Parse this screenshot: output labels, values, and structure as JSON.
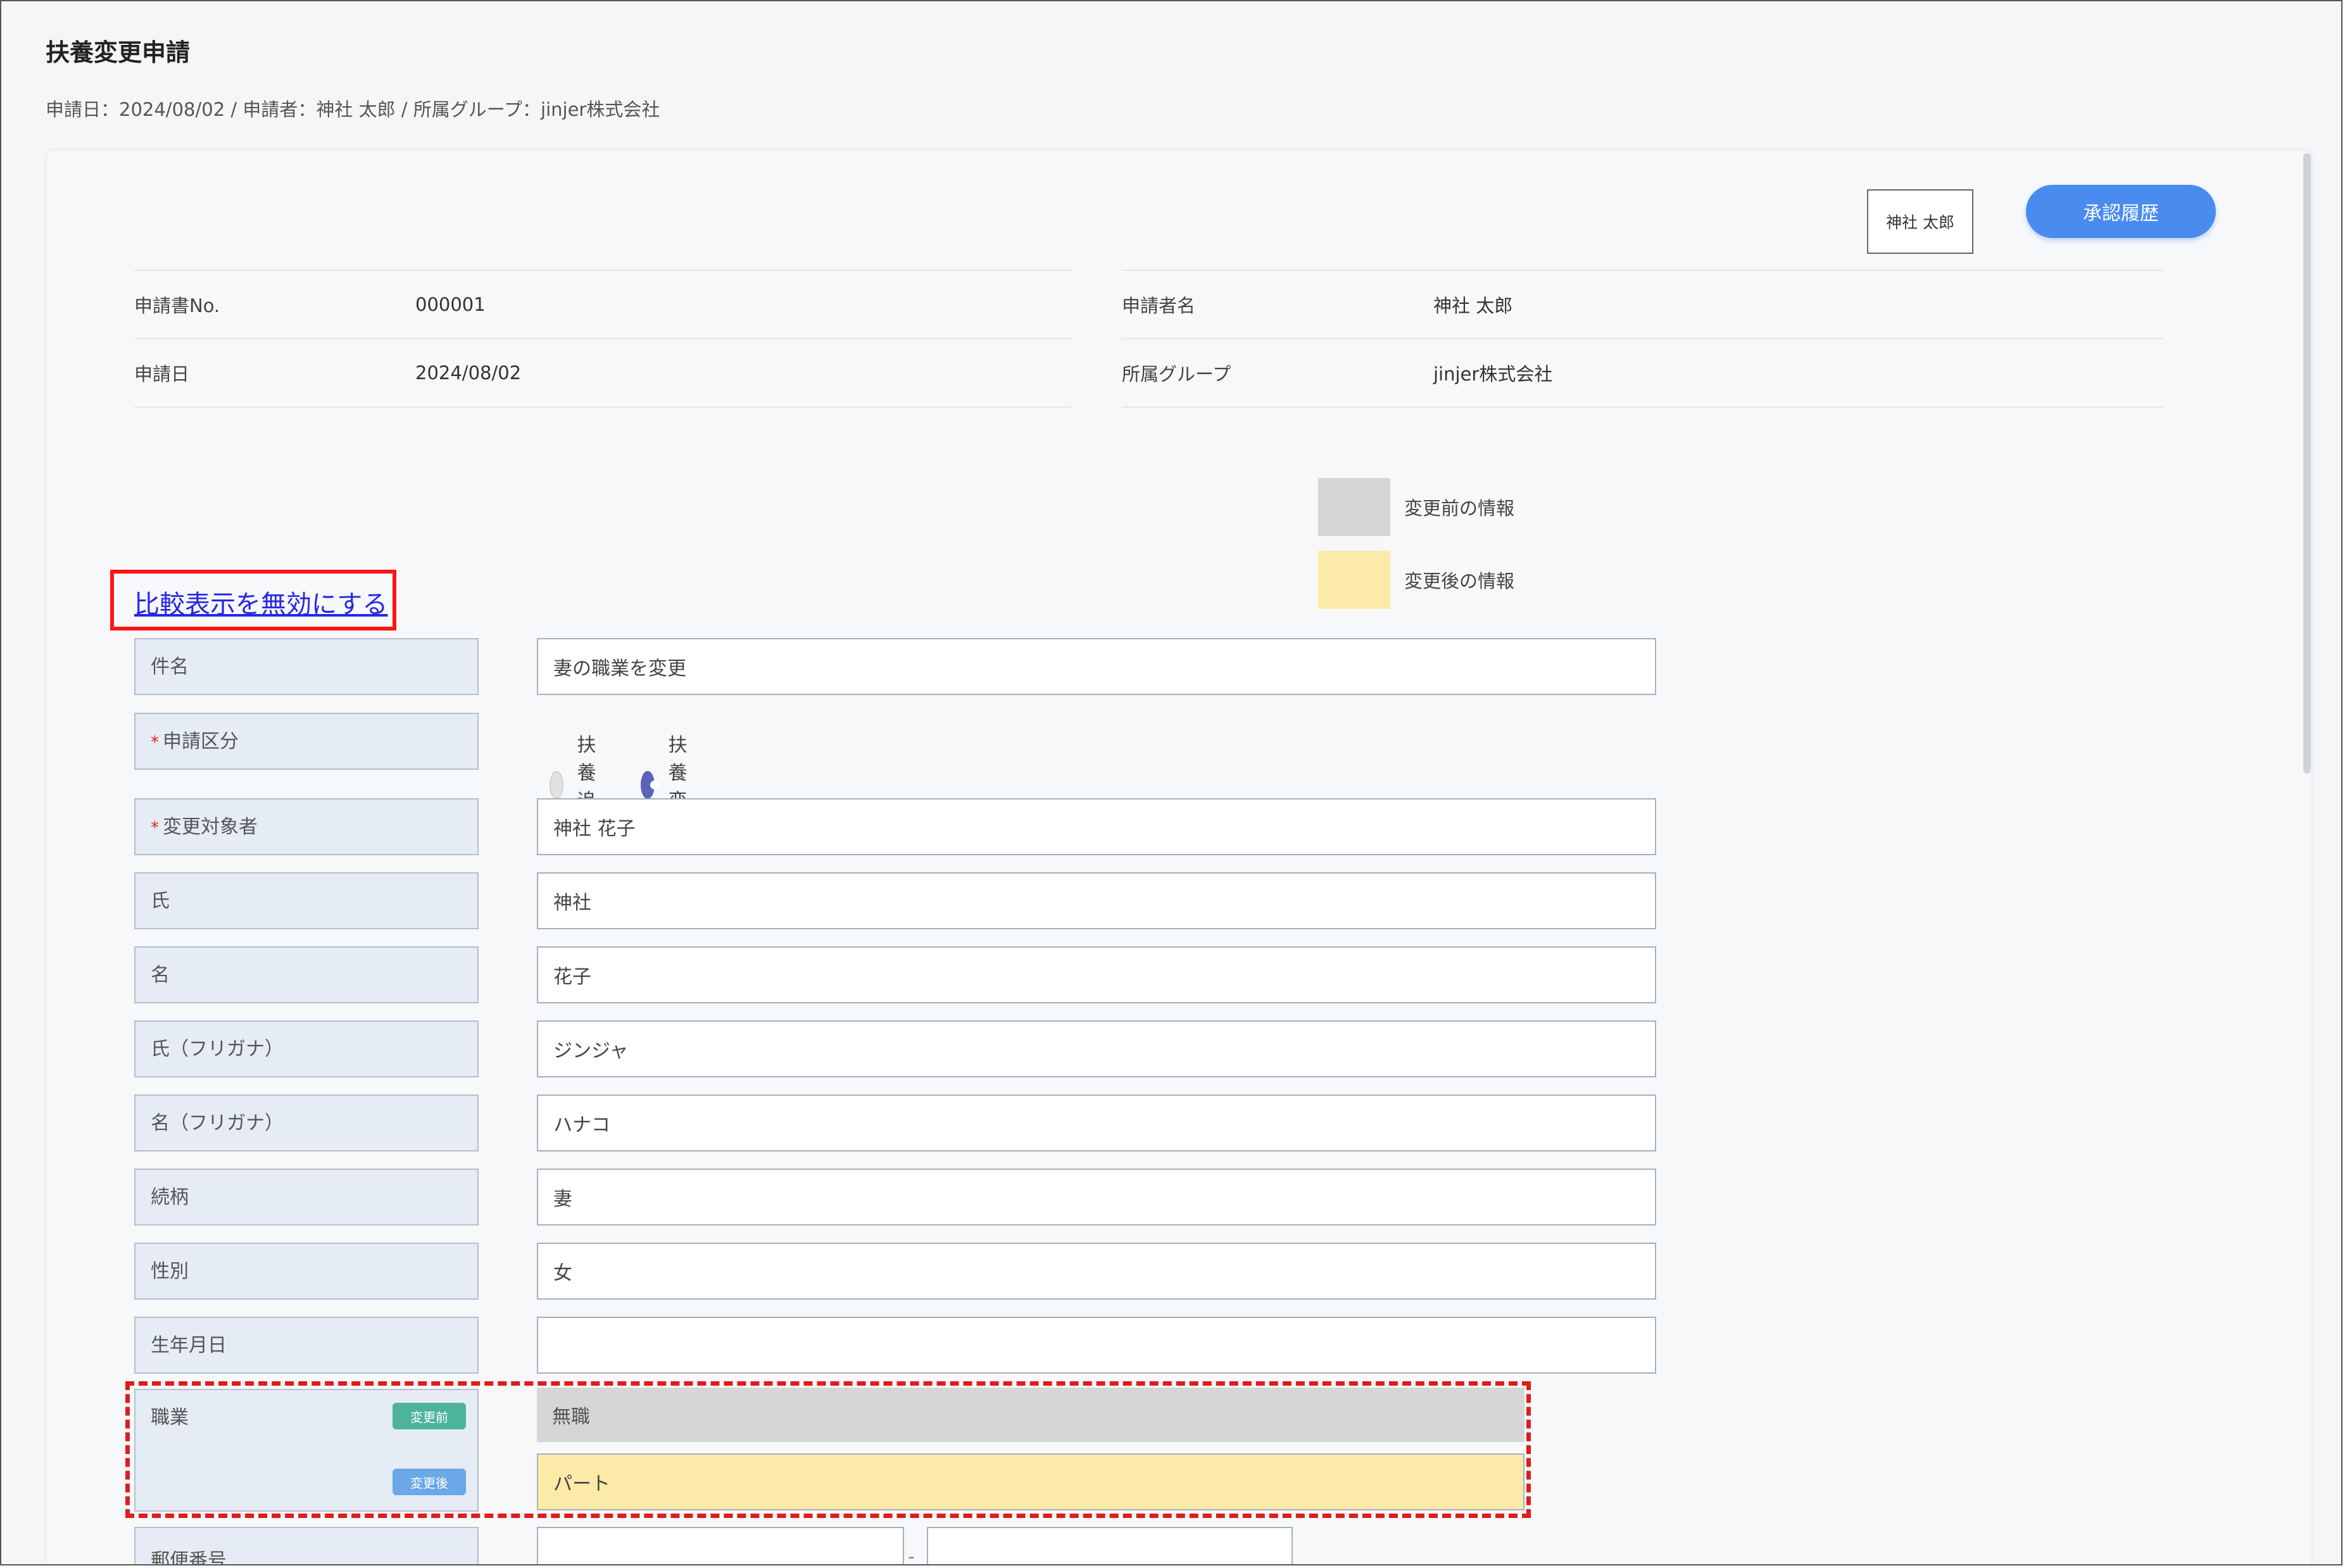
{
  "page": {
    "title": "扶養変更申請",
    "subtitle": "申請日：2024/08/02 / 申請者：神社 太郎 / 所属グループ：jinjer株式会社"
  },
  "header": {
    "approver_name": "神社 太郎",
    "history_button": "承認履歴"
  },
  "info": {
    "left": [
      {
        "label": "申請書No.",
        "value": "000001"
      },
      {
        "label": "申請日",
        "value": "2024/08/02"
      }
    ],
    "right": [
      {
        "label": "申請者名",
        "value": "神社 太郎"
      },
      {
        "label": "所属グループ",
        "value": "jinjer株式会社"
      }
    ]
  },
  "legend": {
    "before_label": "変更前の情報",
    "after_label": "変更後の情報",
    "before_color": "#d6d6d6",
    "after_color": "#fbeaa8"
  },
  "compare_toggle": "比較表示を無効にする",
  "form": {
    "subject": {
      "label": "件名",
      "value": "妻の職業を変更"
    },
    "application_type": {
      "label": "申請区分",
      "options": [
        {
          "label": "扶養追加",
          "selected": false
        },
        {
          "label": "扶養変更",
          "selected": true
        }
      ]
    },
    "target": {
      "label": "変更対象者",
      "value": "神社 花子"
    },
    "last_name": {
      "label": "氏",
      "value": "神社"
    },
    "first_name": {
      "label": "名",
      "value": "花子"
    },
    "last_name_kana": {
      "label": "氏（フリガナ）",
      "value": "ジンジャ"
    },
    "first_name_kana": {
      "label": "名（フリガナ）",
      "value": "ハナコ"
    },
    "relationship": {
      "label": "続柄",
      "value": "妻"
    },
    "gender": {
      "label": "性別",
      "value": "女"
    },
    "birthdate": {
      "label": "生年月日",
      "value": ""
    },
    "occupation": {
      "label": "職業",
      "badge_before": "変更前",
      "badge_after": "変更後",
      "before_value": "無職",
      "after_value": "パート"
    },
    "postal_code": {
      "label": "郵便番号",
      "separator": "-"
    }
  }
}
